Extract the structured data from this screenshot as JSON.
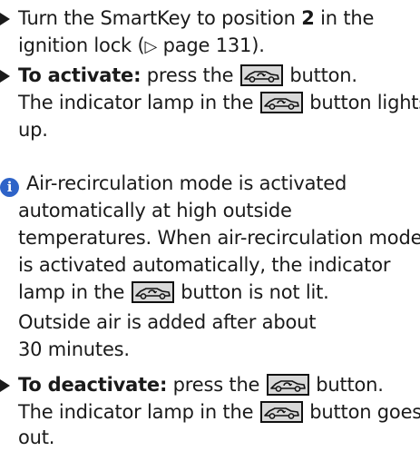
{
  "step1": {
    "prefix": "Turn the SmartKey to position ",
    "position": "2",
    "suffix": " in the",
    "line2_prefix": "ignition lock (",
    "ref_arrow": "▷",
    "line2_suffix": " page 131)."
  },
  "activate": {
    "label": "To activate:",
    "press": " press the ",
    "button_word": " button.",
    "line2_prefix": "The indicator lamp in the ",
    "line2_suffix": " button lights",
    "line3": "up."
  },
  "note": {
    "icon": "info-icon",
    "lines": [
      "Air-recirculation mode is activated",
      "automatically at high outside",
      "temperatures. When air-recirculation mode",
      "is activated automatically, the indicator"
    ],
    "line5_prefix": "lamp in the ",
    "line5_suffix": " button is not lit.",
    "extra_lines": [
      "Outside air is added after about",
      "30 minutes."
    ]
  },
  "deactivate": {
    "label": "To deactivate:",
    "press": " press the ",
    "button_word": " button.",
    "line2_prefix": "The indicator lamp in the ",
    "line2_suffix": " button goes",
    "line3": "out."
  },
  "key_icon": "air-recirculation-icon"
}
